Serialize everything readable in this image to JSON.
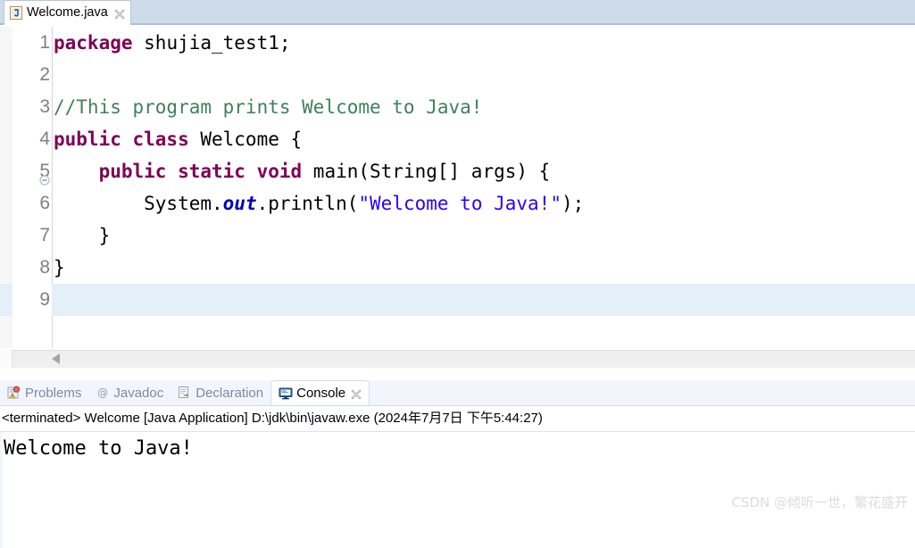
{
  "editor": {
    "tab": {
      "title": "Welcome.java",
      "icon": "java-file-icon",
      "close_icon": "close-icon"
    },
    "gutter": {
      "fold_marker": "⊖"
    },
    "lines": [
      {
        "number": "1",
        "fold": false,
        "tokens": [
          {
            "cls": "kw",
            "text": "package"
          },
          {
            "cls": "plain",
            "text": " shujia_test1;"
          }
        ]
      },
      {
        "number": "2",
        "fold": false,
        "tokens": []
      },
      {
        "number": "3",
        "fold": false,
        "tokens": [
          {
            "cls": "cmt",
            "text": "//This program prints Welcome to Java!"
          }
        ]
      },
      {
        "number": "4",
        "fold": false,
        "tokens": [
          {
            "cls": "kw",
            "text": "public class"
          },
          {
            "cls": "plain",
            "text": " Welcome {"
          }
        ]
      },
      {
        "number": "5",
        "fold": true,
        "tokens": [
          {
            "cls": "plain",
            "text": "    "
          },
          {
            "cls": "kw",
            "text": "public static void"
          },
          {
            "cls": "plain",
            "text": " main(String[] args) {"
          }
        ]
      },
      {
        "number": "6",
        "fold": false,
        "tokens": [
          {
            "cls": "plain",
            "text": "        System."
          },
          {
            "cls": "statfld",
            "text": "out"
          },
          {
            "cls": "plain",
            "text": ".println("
          },
          {
            "cls": "str",
            "text": "\"Welcome to Java!\""
          },
          {
            "cls": "plain",
            "text": ");"
          }
        ]
      },
      {
        "number": "7",
        "fold": false,
        "tokens": [
          {
            "cls": "plain",
            "text": "    }"
          }
        ]
      },
      {
        "number": "8",
        "fold": false,
        "tokens": [
          {
            "cls": "plain",
            "text": "}"
          }
        ]
      },
      {
        "number": "9",
        "fold": false,
        "current": true,
        "tokens": []
      }
    ]
  },
  "bottom_panel": {
    "tabs": [
      {
        "label": "Problems",
        "icon": "problems-icon",
        "active": false,
        "closable": false
      },
      {
        "label": "Javadoc",
        "icon": "javadoc-icon",
        "active": false,
        "closable": false
      },
      {
        "label": "Declaration",
        "icon": "declaration-icon",
        "active": false,
        "closable": false
      },
      {
        "label": "Console",
        "icon": "console-icon",
        "active": true,
        "closable": true
      }
    ],
    "console": {
      "status": "<terminated> Welcome [Java Application] D:\\jdk\\bin\\javaw.exe (2024年7月7日 下午5:44:27)",
      "output": "Welcome to Java!"
    }
  },
  "watermark": {
    "text": "CSDN @倾听一世，繁花盛开"
  },
  "colors": {
    "keyword": "#7F0055",
    "comment": "#3F7F5F",
    "string": "#2A00FF",
    "static_field": "#0000C0",
    "current_line": "#E5EFFA",
    "tabbar": "#CEDBE9"
  }
}
